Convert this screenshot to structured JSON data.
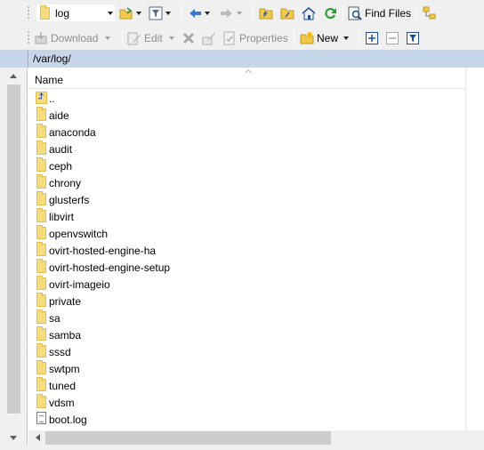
{
  "toolbar1": {
    "location_value": "log",
    "find_files_label": "Find Files"
  },
  "toolbar2": {
    "download_label": "Download",
    "edit_label": "Edit",
    "properties_label": "Properties",
    "new_label": "New"
  },
  "path": "/var/log/",
  "columns": {
    "name": "Name"
  },
  "files": [
    {
      "name": "..",
      "type": "parent"
    },
    {
      "name": "aide",
      "type": "folder"
    },
    {
      "name": "anaconda",
      "type": "folder"
    },
    {
      "name": "audit",
      "type": "folder"
    },
    {
      "name": "ceph",
      "type": "folder"
    },
    {
      "name": "chrony",
      "type": "folder"
    },
    {
      "name": "glusterfs",
      "type": "folder"
    },
    {
      "name": "libvirt",
      "type": "folder"
    },
    {
      "name": "openvswitch",
      "type": "folder"
    },
    {
      "name": "ovirt-hosted-engine-ha",
      "type": "folder"
    },
    {
      "name": "ovirt-hosted-engine-setup",
      "type": "folder"
    },
    {
      "name": "ovirt-imageio",
      "type": "folder"
    },
    {
      "name": "private",
      "type": "folder"
    },
    {
      "name": "sa",
      "type": "folder"
    },
    {
      "name": "samba",
      "type": "folder"
    },
    {
      "name": "sssd",
      "type": "folder"
    },
    {
      "name": "swtpm",
      "type": "folder"
    },
    {
      "name": "tuned",
      "type": "folder"
    },
    {
      "name": "vdsm",
      "type": "folder"
    },
    {
      "name": "boot.log",
      "type": "file"
    }
  ],
  "colors": {
    "folder": "#f7dc7e",
    "path_bar": "#c7d7e9",
    "toolbar": "#f0f0f0"
  }
}
